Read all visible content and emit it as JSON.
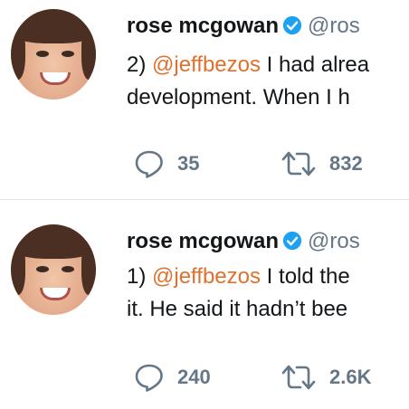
{
  "tweets": [
    {
      "author_name": "rose mcgowan",
      "handle": "@ros",
      "text_prefix": "2) ",
      "mention": "@jeffbezos",
      "text_line1_rest": " I had alrea",
      "text_line2": "development. When I h",
      "reply_count": "35",
      "retweet_count": "832",
      "icons": {
        "verified": "verified-badge-icon",
        "reply": "reply-icon",
        "retweet": "retweet-icon"
      }
    },
    {
      "author_name": "rose mcgowan",
      "handle": "@ros",
      "text_prefix": "1) ",
      "mention": "@jeffbezos",
      "text_line1_rest": " I told the",
      "text_line2": "it. He said it hadn’t bee",
      "reply_count": "240",
      "retweet_count": "2.6K",
      "icons": {
        "verified": "verified-badge-icon",
        "reply": "reply-icon",
        "retweet": "retweet-icon"
      }
    }
  ],
  "colors": {
    "verified_blue": "#1da1f2",
    "mention_orange": "#e0702d",
    "muted_gray": "#657786",
    "divider": "#e1e8ed"
  }
}
